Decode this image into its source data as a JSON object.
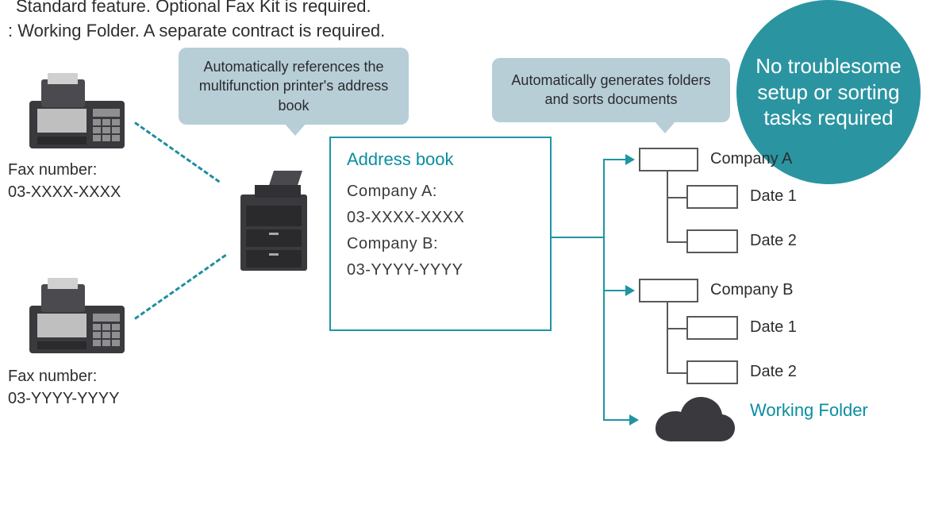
{
  "captions": {
    "line1": "Standard feature. Optional Fax Kit is required.",
    "line2": ": Working Folder. A separate contract is required."
  },
  "fax": {
    "a": {
      "label_line1": "Fax number:",
      "label_line2": "03-XXXX-XXXX"
    },
    "b": {
      "label_line1": "Fax number:",
      "label_line2": "03-YYYY-YYYY"
    }
  },
  "callouts": {
    "ref": "Automatically references the multifunction printer's address book",
    "sort": "Automatically generates folders and sorts documents"
  },
  "badge": {
    "text": "No troublesome setup or sorting tasks required"
  },
  "address_book": {
    "title": "Address book",
    "entries": {
      "a_name": "Company A:",
      "a_num": "03-XXXX-XXXX",
      "b_name": "Company B:",
      "b_num": "03-YYYY-YYYY"
    }
  },
  "tree": {
    "company_a": "Company A",
    "company_b": "Company B",
    "date1": "Date 1",
    "date2": "Date 2"
  },
  "cloud": {
    "label": "Working Folder"
  },
  "colors": {
    "callout_bg": "#b7ced7",
    "accent": "#1e95a3",
    "badge_bg": "#2b94a1",
    "icon_gray": "#595959"
  }
}
